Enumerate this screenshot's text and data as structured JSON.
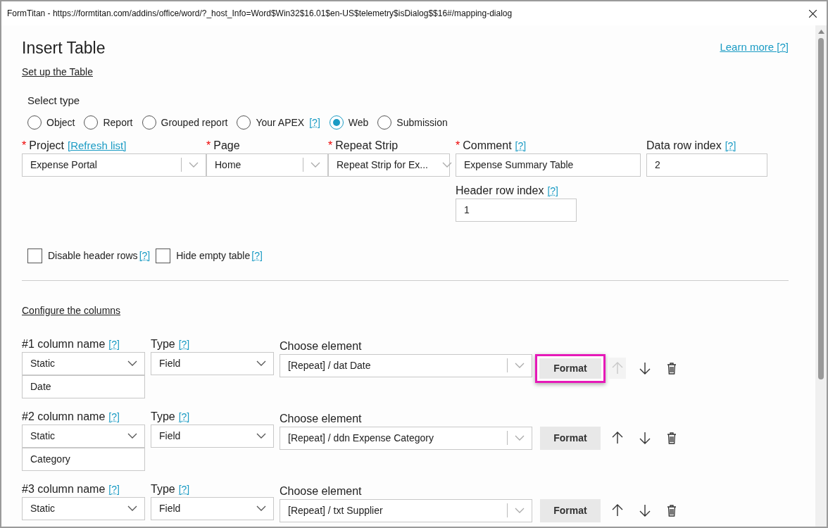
{
  "window": {
    "title": "FormTitan - https://formtitan.com/addins/office/word/?_host_Info=Word$Win32$16.01$en-US$telemetry$isDialog$$16#/mapping-dialog"
  },
  "heading": "Insert Table",
  "learn_more": "Learn more [?]",
  "setup_link": "Set up the Table",
  "select_type": {
    "label": "Select type",
    "options": [
      {
        "label": "Object",
        "selected": false
      },
      {
        "label": "Report",
        "selected": false
      },
      {
        "label": "Grouped report",
        "selected": false
      },
      {
        "label": "Your APEX",
        "help": "[?]",
        "selected": false
      },
      {
        "label": "Web",
        "selected": true
      },
      {
        "label": "Submission",
        "selected": false
      }
    ]
  },
  "selects": [
    {
      "label": "Project",
      "required_mark": "*",
      "link": "[Refresh list]",
      "value": "Expense Portal"
    },
    {
      "label": "Page",
      "required_mark": "*",
      "value": "Home"
    },
    {
      "label": "Repeat Strip",
      "required_mark": "*",
      "value": "Repeat Strip for Ex..."
    }
  ],
  "comment": {
    "label": "Comment",
    "required_mark": "*",
    "help": "[?]",
    "value": "Expense Summary Table"
  },
  "data_row_index": {
    "label": "Data row index",
    "help": "[?]",
    "value": "2"
  },
  "header_row_index": {
    "label": "Header row index",
    "help": "[?]",
    "value": "1"
  },
  "checkboxes": [
    {
      "label": "Disable header rows",
      "help": "[?]",
      "checked": false
    },
    {
      "label": "Hide empty table",
      "help": "[?]",
      "checked": false
    }
  ],
  "configure_link": "Configure the columns",
  "columns": [
    {
      "name_label": "#1 column name",
      "name_help": "[?]",
      "name_mode": "Static",
      "name_value": "Date",
      "type_label": "Type",
      "type_help": "[?]",
      "type_value": "Field",
      "element_label": "Choose element",
      "element_value": "[Repeat] / dat Date",
      "format": "Format",
      "highlighted": true,
      "up_disabled": true
    },
    {
      "name_label": "#2 column name",
      "name_help": "[?]",
      "name_mode": "Static",
      "name_value": "Category",
      "type_label": "Type",
      "type_help": "[?]",
      "type_value": "Field",
      "element_label": "Choose element",
      "element_value": "[Repeat] / ddn Expense Category",
      "format": "Format",
      "highlighted": false,
      "up_disabled": false
    },
    {
      "name_label": "#3 column name",
      "name_help": "[?]",
      "name_mode": "Static",
      "type_label": "Type",
      "type_help": "[?]",
      "type_value": "Field",
      "element_label": "Choose element",
      "element_value": "[Repeat] / txt Supplier",
      "format": "Format",
      "highlighted": false,
      "up_disabled": false
    }
  ]
}
